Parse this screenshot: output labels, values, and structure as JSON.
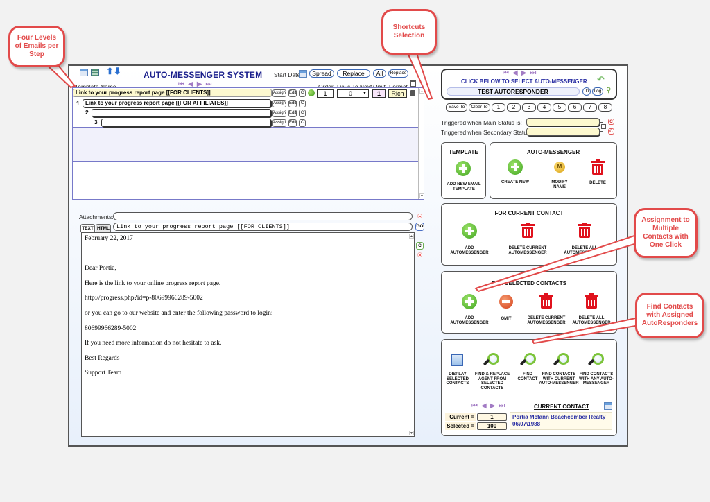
{
  "app": {
    "title": "AUTO-MESSENGER SYSTEM",
    "start_date_label": "Start Date",
    "buttons": {
      "spread": "Spread",
      "replace": "Replace",
      "all": "All",
      "replace_small": "Replace"
    }
  },
  "template_table": {
    "template_name_label": "Template Name",
    "columns": {
      "order": "Order",
      "days_to_next": "Days To Next",
      "omit": "Omit",
      "format": "Format"
    },
    "main_row": {
      "name": "Link to your progress report page [[FOR CLIENTS]]",
      "order": "1",
      "days_to_next": "0",
      "omit": "1",
      "format": "Rich"
    },
    "levels": [
      {
        "num": "1",
        "name": "Link to your progress report page [[FOR AFFILIATES]]"
      },
      {
        "num": "2",
        "name": ""
      },
      {
        "num": "3",
        "name": ""
      }
    ],
    "row_buttons": {
      "assign": "Assign",
      "edit": "Edit",
      "c": "C"
    }
  },
  "editor": {
    "attachments_label": "Attachments:",
    "attachments_value": "",
    "tabs": [
      "TEXT",
      "HTML"
    ],
    "subject": "Link to your progress report page [[FOR CLIENTS]]",
    "go_label": "GO",
    "c_label": "C",
    "body": [
      "February 22, 2017",
      "",
      "Dear Portia,",
      "Here is the link to your online progress report page.",
      "http://progress.php?id=p-80699966289-5002",
      "or you can go to our website  and enter the following password to login:",
      "80699966289-5002",
      "If you need more information do not hesitate to ask.",
      "Best Regards",
      "Support Team"
    ]
  },
  "auto_messenger": {
    "select_prompt": "CLICK  BELOW TO SELECT AUTO-MESSENGER",
    "selected": "TEST AUTORESPONDER",
    "id_label": "ID",
    "log_label": "Log",
    "shortcuts": [
      "Save To",
      "Clear To",
      "1",
      "2",
      "3",
      "4",
      "5",
      "6",
      "7",
      "8"
    ],
    "trigger_main_label": "Triggered when Main Status is:",
    "trigger_secondary_label": "Triggered when Secondary Status:",
    "trigger_main_value": "",
    "trigger_secondary_value": "",
    "c_label": "C"
  },
  "template_section": {
    "title": "TEMPLATE",
    "add_label": "ADD NEW EMAIL TEMPLATE"
  },
  "am_section": {
    "title": "AUTO-MESSENGER",
    "create_label": "CREATE NEW",
    "modify_label": "MODIFY NAME",
    "delete_label": "DELETE",
    "modify_icon_letter": "M"
  },
  "current_contact_section": {
    "title": "FOR CURRENT CONTACT",
    "add_label": "ADD AUTOMESSENGER",
    "delete_current_label": "DELETE CURRENT AUTOMESSENGER",
    "delete_all_label": "DELETE ALL AUTOMESSENGERS"
  },
  "selected_contacts_section": {
    "title": "FOR SELECTED CONTACTS",
    "add_label": "ADD AUTOMESSENGER",
    "omit_label": "OMIT",
    "delete_current_label": "DELETE CURRENT AUTOMESSENGER",
    "delete_all_label": "DELETE ALL AUTOMESSENGER"
  },
  "find_section": {
    "display_label": "DISPLAY SELECTED CONTACTS",
    "find_replace_label": "FIND & REPLACE AGENT FROM SELECTED CONTACTS",
    "find_contact_label": "FIND CONTACT",
    "find_current_label": "FIND CONTACTS WITH CURRENT AUTO-MESSENGER",
    "find_any_label": "FIND CONTACTS WITH ANY AUTO-MESSENGER",
    "current_contact_title": "CURRENT CONTACT",
    "current_label": "Current =",
    "current_value": "1",
    "selected_label": "Selected =",
    "selected_value": "100",
    "contact_name": "Portia Mcfann Beachcomber Realty",
    "contact_date": "06\\07\\1988"
  },
  "callouts": {
    "four_levels": "Four Levels of Emails per Step",
    "shortcuts": "Shortcuts Selection",
    "assignment": "Assignment to Multiple Contacts with One Click",
    "find": "Find Contacts with Assigned AutoResponders"
  },
  "colors": {
    "title_blue": "#1a1f8c",
    "callout_red": "#e24a4a",
    "nav_purple": "#a27bc4",
    "trash_red": "#e0121d",
    "plus_green": "#3fa41f",
    "field_yellow": "#fdf9cf"
  }
}
